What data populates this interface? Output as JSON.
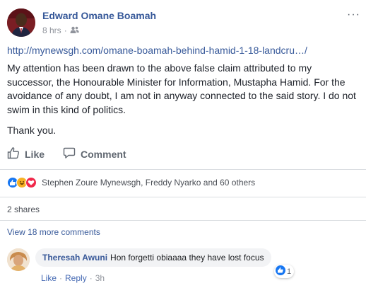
{
  "post": {
    "author": "Edward Omane Boamah",
    "time": "8 hrs",
    "audience_separator": "·",
    "more_label": "···",
    "link": "http://mynewsgh.com/omane-boamah-behind-hamid-1-18-landcru…/",
    "paragraph1": "My attention has been drawn to the above false claim attributed to my successor, the Honourable Minister for Information, Mustapha Hamid. For the avoidance of any doubt, I am not in anyway connected to the said story. I do not swim in this kind of politics.",
    "paragraph2": "Thank you."
  },
  "actions": {
    "like_label": "Like",
    "comment_label": "Comment"
  },
  "reactions": {
    "summary": "Stephen Zoure Mynewsgh, Freddy Nyarko and 60 others",
    "types": [
      "like",
      "haha",
      "love"
    ]
  },
  "shares": {
    "label": "2 shares"
  },
  "comments": {
    "view_more": "View 18 more comments",
    "items": [
      {
        "author": "Theresah Awuni",
        "text": "Hon forgetti obiaaaa they have lost focus",
        "like_action": "Like",
        "reply_action": "Reply",
        "dot": "·",
        "time": "3h",
        "like_count": "1"
      }
    ]
  },
  "colors": {
    "link": "#365899",
    "like_blue": "#1877f2",
    "haha_yellow": "#f7b125",
    "love_red": "#f0284a"
  }
}
